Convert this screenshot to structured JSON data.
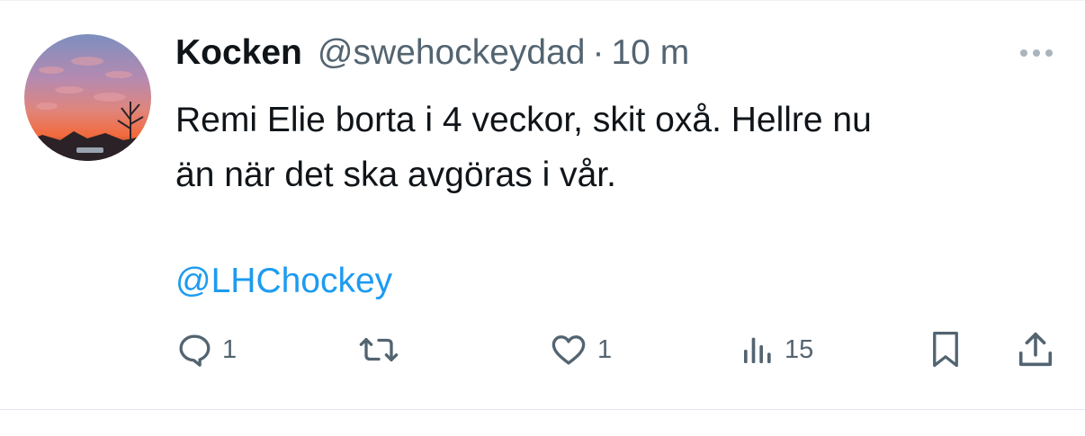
{
  "tweet": {
    "author": {
      "display_name": "Kocken",
      "handle": "@swehockeydad",
      "separator": "·",
      "time": "10 m"
    },
    "text_lines": [
      "Remi Elie borta i 4 veckor, skit oxå. Hellre nu",
      "än när det ska avgöras i vår."
    ],
    "mention": "@LHChockey",
    "actions": {
      "reply_count": "1",
      "like_count": "1",
      "views_count": "15"
    }
  },
  "icons": {
    "more": "more-horizontal-icon",
    "reply": "reply-icon",
    "retweet": "retweet-icon",
    "like": "heart-icon",
    "views": "views-bar-chart-icon",
    "bookmark": "bookmark-icon",
    "share": "share-upload-icon"
  },
  "colors": {
    "text": "#0f1419",
    "secondary": "#536471",
    "link": "#1d9bf0"
  }
}
